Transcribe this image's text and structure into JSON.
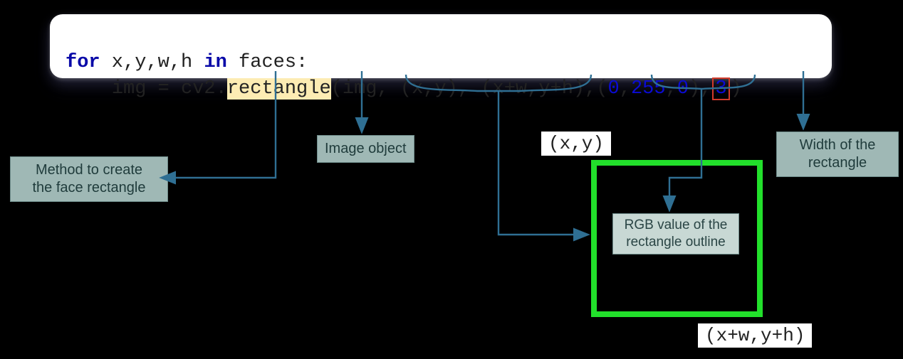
{
  "code": {
    "kw_for": "for",
    "loop_vars": " x,y,w,h ",
    "kw_in": "in",
    "iter": " faces:",
    "indent": "    ",
    "assign": "img = cv2.",
    "method": "rectangle",
    "after_method": "(img, (x,y), (x+w,y+h),(",
    "num0a": "0",
    "comma": ",",
    "num255": "255",
    "num0b": "0",
    "close_tuple": "),",
    "num3": "3",
    "close_paren": ")"
  },
  "labels": {
    "method": "Method to create\nthe face rectangle",
    "image_obj": "Image object",
    "xy": "(x,y)",
    "rgb": "RGB value of the\nrectangle outline",
    "width": "Width of the\nrectangle",
    "xywh": "(x+w,y+h)"
  },
  "colors": {
    "arrow": "#2f6f93",
    "green": "#22e02b",
    "labelbg": "#9fb8b5"
  }
}
